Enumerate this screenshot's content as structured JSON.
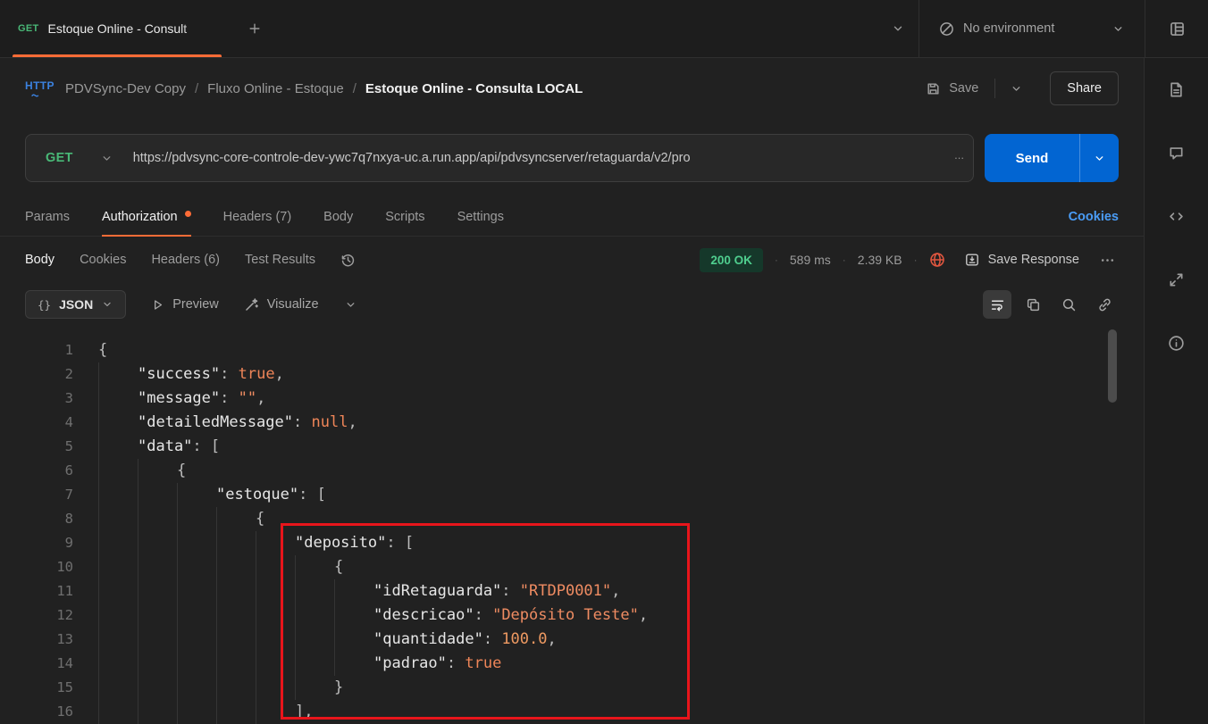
{
  "theme": {
    "accent_orange": "#ff6c37",
    "method_get_green": "#49b877",
    "send_button_blue": "#0265d2",
    "link_blue": "#4a9cf5",
    "status_ok_green": "#4fce8e",
    "highlight_box_red": "#e8151b",
    "json_value_orange": "#ef8c62",
    "background_dark": "#212121"
  },
  "icons": [
    "new-tab-plus-icon",
    "chevron-down-icon",
    "no-environment-icon",
    "grid-panel-icon",
    "http-logo",
    "save-floppy-icon",
    "document-icon",
    "comment-icon",
    "code-icon",
    "expand-icon",
    "info-icon",
    "clock-history-icon",
    "globe-warning-icon",
    "save-response-icon",
    "more-ellipsis-icon",
    "json-braces-icon",
    "play-preview-icon",
    "visualize-wand-icon",
    "wrap-text-icon",
    "copy-icon",
    "search-icon",
    "link-icon"
  ],
  "topbar": {
    "tab": {
      "method": "GET",
      "title": "Estoque Online - Consult"
    },
    "environment_label": "No environment"
  },
  "breadcrumb": {
    "protocol": "HTTP",
    "separator": "/",
    "items": [
      "PDVSync-Dev Copy",
      "Fluxo Online - Estoque",
      "Estoque Online - Consulta LOCAL"
    ],
    "save_label": "Save",
    "share_label": "Share"
  },
  "request": {
    "method": "GET",
    "url": "https://pdvsync-core-controle-dev-ywc7q7nxya-uc.a.run.app/api/pdvsyncserver/retaguarda/v2/pro",
    "url_truncated": "...",
    "send_label": "Send",
    "tabs": [
      {
        "label": "Params",
        "active": false
      },
      {
        "label": "Authorization",
        "active": true,
        "dot": true
      },
      {
        "label": "Headers (7)",
        "active": false
      },
      {
        "label": "Body",
        "active": false
      },
      {
        "label": "Scripts",
        "active": false
      },
      {
        "label": "Settings",
        "active": false
      }
    ],
    "cookies_link": "Cookies"
  },
  "response": {
    "tabs": [
      {
        "label": "Body",
        "active": true
      },
      {
        "label": "Cookies",
        "active": false
      },
      {
        "label": "Headers (6)",
        "active": false
      },
      {
        "label": "Test Results",
        "active": false
      }
    ],
    "status": "200 OK",
    "time": "589 ms",
    "size": "2.39 KB",
    "separator": "·",
    "save_response_label": "Save Response",
    "toolbar": {
      "braces": "{}",
      "format": "JSON",
      "preview": "Preview",
      "visualize": "Visualize"
    }
  },
  "code": {
    "lines": [
      {
        "n": 1,
        "indent": 0,
        "tokens": [
          {
            "t": "p",
            "v": "{"
          }
        ]
      },
      {
        "n": 2,
        "indent": 1,
        "tokens": [
          {
            "t": "key",
            "v": "\"success\""
          },
          {
            "t": "p",
            "v": ": "
          },
          {
            "t": "kw",
            "v": "true"
          },
          {
            "t": "p",
            "v": ","
          }
        ]
      },
      {
        "n": 3,
        "indent": 1,
        "tokens": [
          {
            "t": "key",
            "v": "\"message\""
          },
          {
            "t": "p",
            "v": ": "
          },
          {
            "t": "str",
            "v": "\"\""
          },
          {
            "t": "p",
            "v": ","
          }
        ]
      },
      {
        "n": 4,
        "indent": 1,
        "tokens": [
          {
            "t": "key",
            "v": "\"detailedMessage\""
          },
          {
            "t": "p",
            "v": ": "
          },
          {
            "t": "kw",
            "v": "null"
          },
          {
            "t": "p",
            "v": ","
          }
        ]
      },
      {
        "n": 5,
        "indent": 1,
        "tokens": [
          {
            "t": "key",
            "v": "\"data\""
          },
          {
            "t": "p",
            "v": ": ["
          }
        ]
      },
      {
        "n": 6,
        "indent": 2,
        "tokens": [
          {
            "t": "p",
            "v": "{"
          }
        ]
      },
      {
        "n": 7,
        "indent": 3,
        "tokens": [
          {
            "t": "key",
            "v": "\"estoque\""
          },
          {
            "t": "p",
            "v": ": ["
          }
        ]
      },
      {
        "n": 8,
        "indent": 4,
        "tokens": [
          {
            "t": "p",
            "v": "{"
          }
        ]
      },
      {
        "n": 9,
        "indent": 5,
        "tokens": [
          {
            "t": "key",
            "v": "\"deposito\""
          },
          {
            "t": "p",
            "v": ": ["
          }
        ]
      },
      {
        "n": 10,
        "indent": 6,
        "tokens": [
          {
            "t": "p",
            "v": "{"
          }
        ]
      },
      {
        "n": 11,
        "indent": 7,
        "tokens": [
          {
            "t": "key",
            "v": "\"idRetaguarda\""
          },
          {
            "t": "p",
            "v": ": "
          },
          {
            "t": "str",
            "v": "\"RTDP0001\""
          },
          {
            "t": "p",
            "v": ","
          }
        ]
      },
      {
        "n": 12,
        "indent": 7,
        "tokens": [
          {
            "t": "key",
            "v": "\"descricao\""
          },
          {
            "t": "p",
            "v": ": "
          },
          {
            "t": "str",
            "v": "\"Depósito Teste\""
          },
          {
            "t": "p",
            "v": ","
          }
        ]
      },
      {
        "n": 13,
        "indent": 7,
        "tokens": [
          {
            "t": "key",
            "v": "\"quantidade\""
          },
          {
            "t": "p",
            "v": ": "
          },
          {
            "t": "num",
            "v": "100.0"
          },
          {
            "t": "p",
            "v": ","
          }
        ]
      },
      {
        "n": 14,
        "indent": 7,
        "tokens": [
          {
            "t": "key",
            "v": "\"padrao\""
          },
          {
            "t": "p",
            "v": ": "
          },
          {
            "t": "kw",
            "v": "true"
          }
        ]
      },
      {
        "n": 15,
        "indent": 6,
        "tokens": [
          {
            "t": "p",
            "v": "}"
          }
        ]
      },
      {
        "n": 16,
        "indent": 5,
        "tokens": [
          {
            "t": "p",
            "v": "],"
          }
        ]
      }
    ]
  }
}
